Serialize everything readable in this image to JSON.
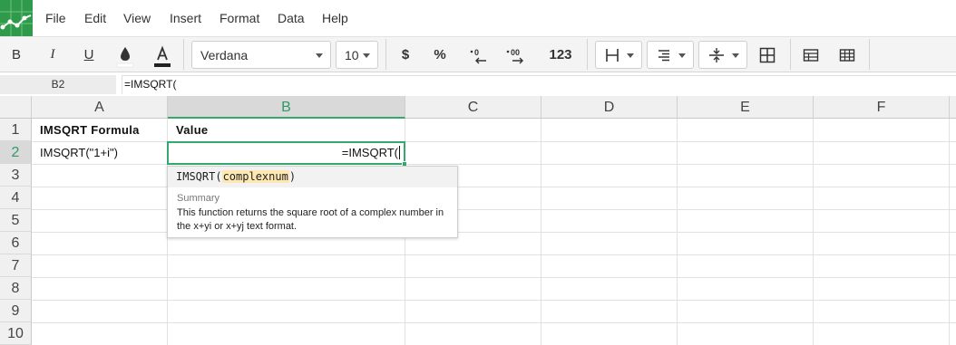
{
  "menu": {
    "items": [
      "File",
      "Edit",
      "View",
      "Insert",
      "Format",
      "Data",
      "Help"
    ]
  },
  "toolbar": {
    "bold": "B",
    "italic": "I",
    "underline": "U",
    "font_family": "Verdana",
    "font_size": "10",
    "currency": "$",
    "percent": "%",
    "number_format": "123",
    "fill_color": "#000000",
    "text_color": "#222222"
  },
  "formula_bar": {
    "cell_ref": "B2",
    "formula": "=IMSQRT("
  },
  "grid": {
    "columns": [
      "A",
      "B",
      "C",
      "D",
      "E",
      "F"
    ],
    "rows": [
      "1",
      "2",
      "3",
      "4",
      "5",
      "6",
      "7",
      "8",
      "9",
      "10"
    ],
    "active_column": "B",
    "active_row": "2",
    "accent_color": "#34a86f",
    "cells": {
      "A1": "IMSQRT Formula",
      "B1": "Value",
      "A2": "IMSQRT(\"1+i\")",
      "B2": "=IMSQRT("
    }
  },
  "autocomplete": {
    "function_name": "IMSQRT(",
    "argument": "complexnum",
    "close_paren": ")",
    "summary_label": "Summary",
    "description": "This function returns the square root of a complex number in the x+yi or x+yj text format."
  }
}
